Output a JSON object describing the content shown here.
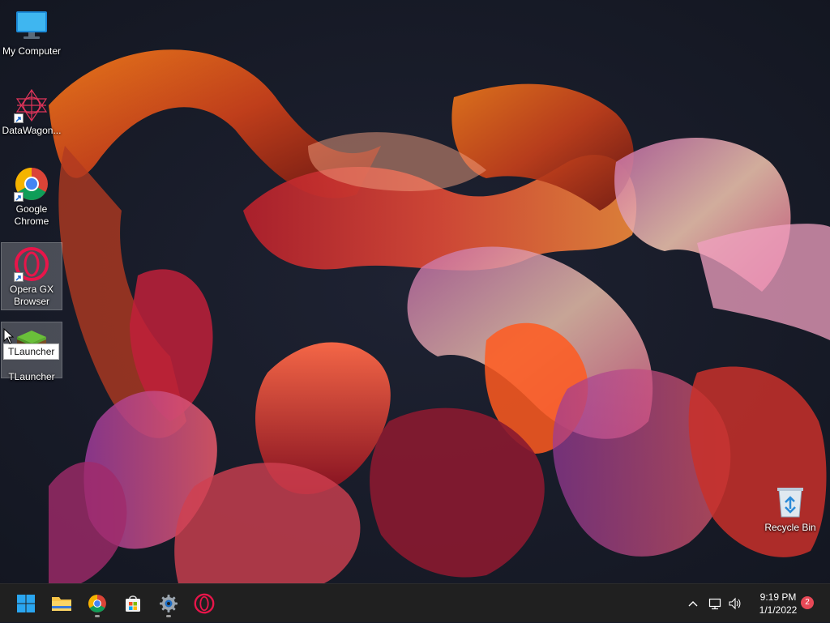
{
  "desktop": {
    "icons": [
      {
        "label": "My Computer",
        "icon": "computer-icon"
      },
      {
        "label": "DataWagon...",
        "icon": "datawagon-icon"
      },
      {
        "label": "Google Chrome",
        "icon": "chrome-icon"
      },
      {
        "label": "Opera GX Browser",
        "icon": "opera-gx-icon"
      },
      {
        "label": "TLauncher",
        "icon": "tlauncher-icon"
      },
      {
        "label": "Recycle Bin",
        "icon": "recycle-bin-icon"
      }
    ],
    "tooltip": "TLauncher"
  },
  "taskbar": {
    "pinned": [
      "start-icon",
      "file-explorer-icon",
      "chrome-icon",
      "microsoft-store-icon",
      "settings-icon",
      "opera-icon"
    ],
    "tray": {
      "time": "9:19 PM",
      "date": "1/1/2022",
      "notifications": "2"
    }
  },
  "colors": {
    "taskbar": "#202020",
    "accent": "#0078d4",
    "badge": "#e74856"
  }
}
